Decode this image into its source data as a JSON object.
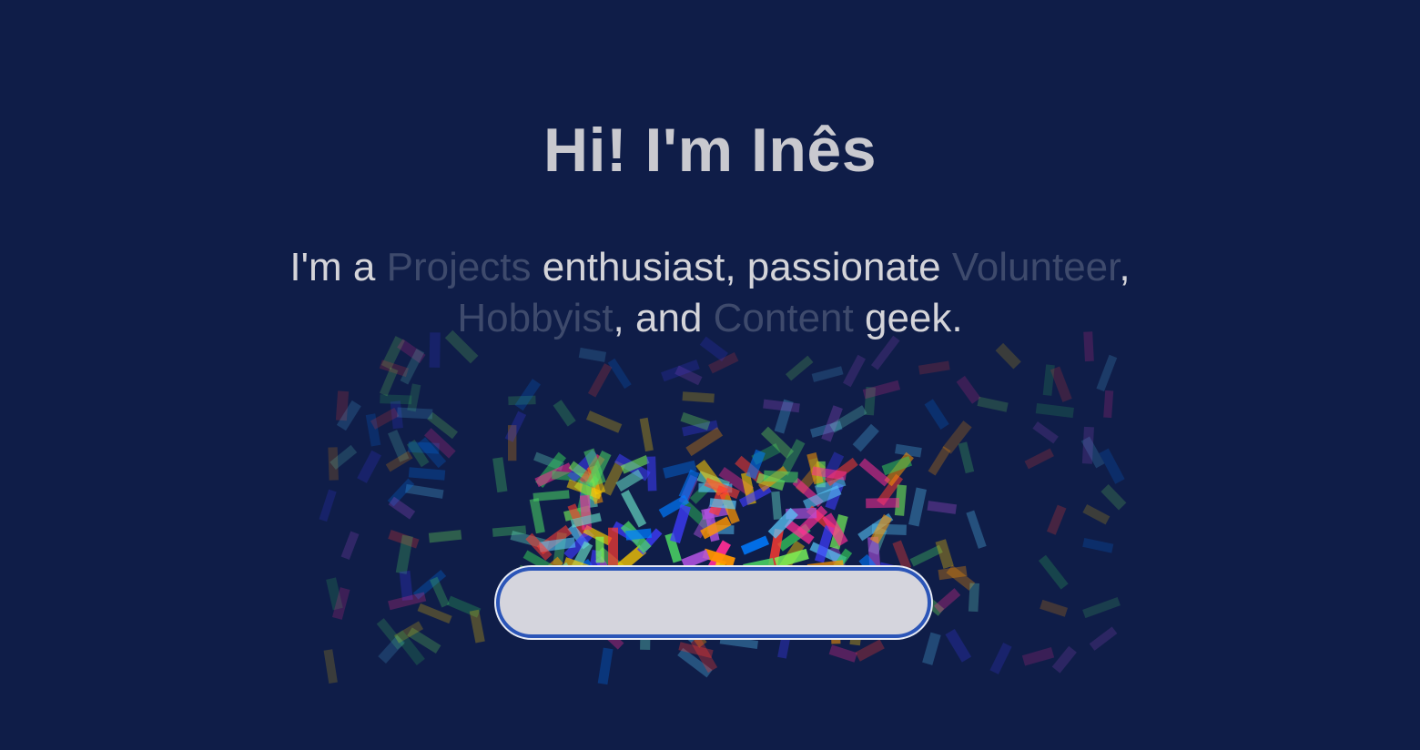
{
  "hero": {
    "title": "Hi! I'm Inês",
    "intro": {
      "lead": "I'm a ",
      "role_1": "Projects",
      "text_1": " enthusiast, passionate ",
      "role_2": "Volunteer",
      "text_2": ",",
      "role_3": "Hobbyist",
      "text_3": ", and ",
      "role_4": "Content",
      "text_4": " geek."
    }
  },
  "cta": {
    "label": ""
  },
  "colors": {
    "background": "#0f1d48",
    "title": "#c9c9cf",
    "text": "#d4d4d9",
    "muted_text": "#3e4a6c",
    "button_fill": "#d5d5dd",
    "button_border": "#2b55b8"
  },
  "confetti": {
    "palette": [
      "#ff3b30",
      "#ff9500",
      "#ffcc00",
      "#4cd964",
      "#34c759",
      "#5ac8fa",
      "#007aff",
      "#3f3cff",
      "#af52de",
      "#ff2d95",
      "#7dff5a",
      "#6be3c9"
    ]
  }
}
